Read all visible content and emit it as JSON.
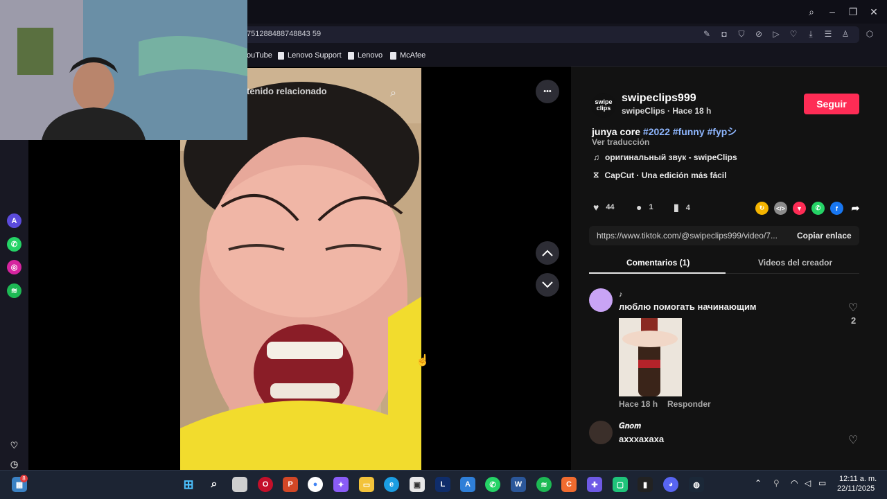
{
  "browser": {
    "url": "7512884887488435 9",
    "url_visible": "751288488748843 59",
    "bookmarks": [
      "ouTube",
      "Lenovo Support",
      "Lenovo",
      "McAfee"
    ]
  },
  "video": {
    "search_placeholder": "tenido relacionado",
    "more_label": "•••",
    "nav_up": "⌃",
    "nav_down": "⌄"
  },
  "post": {
    "avatar_text_1": "swipe",
    "avatar_text_2": "clips",
    "username": "swipeclips999",
    "subline": "swipeClips · Hace 18 h",
    "follow_label": "Seguir",
    "caption_prefix": "junya core ",
    "caption_tags": "#2022 #funny #fypシ",
    "translate_label": "Ver traducción",
    "music": "оригинальный звук - swipeClips",
    "capcut": "CapCut · Una edición más fácil",
    "likes": "44",
    "comments": "1",
    "saves": "4",
    "link": "https://www.tiktok.com/@swipeclips999/video/7...",
    "copy_link": "Copiar enlace",
    "tab_comments": "Comentarios (1)",
    "tab_videos": "Videos del creador"
  },
  "comments": [
    {
      "name": "♪",
      "text": "люблю помогать начинающим",
      "time": "Hace 18 h",
      "reply": "Responder",
      "likes": "2"
    },
    {
      "name": "𝑮𝒏𝒐𝒎",
      "text": "ахххахаха"
    }
  ],
  "taskbar": {
    "badge_count": "8",
    "time": "12:11 a. m.",
    "date": "22/11/2025"
  },
  "colors": {
    "follow_red": "#fe2c55",
    "hashtag_blue": "#8fb7ff",
    "panel_bg": "#121212"
  }
}
